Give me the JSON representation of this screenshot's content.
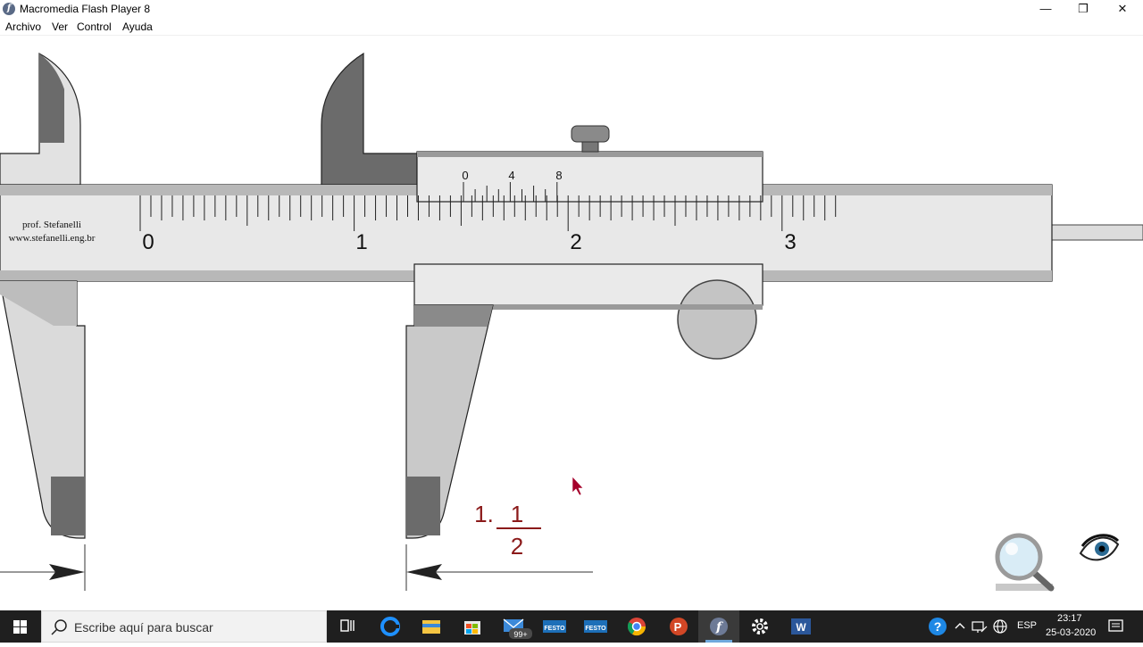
{
  "window": {
    "title": "Macromedia Flash Player 8",
    "controls": {
      "minimize": "—",
      "maximize": "❐",
      "close": "✕"
    }
  },
  "menu": [
    "Archivo",
    "Ver",
    "Control",
    "Ayuda"
  ],
  "caliper": {
    "credit_name": "prof. Stefanelli",
    "credit_url": "www.stefanelli.eng.br",
    "main_scale_labels": [
      "0",
      "1",
      "2",
      "3"
    ],
    "vernier_scale_labels": [
      "0",
      "4",
      "8"
    ],
    "colors": {
      "body": "#e6e6e6",
      "shade": "#bdbdbd",
      "dark": "#6b6b6b",
      "outline": "#1a1a1a"
    }
  },
  "answer": {
    "whole": "1.",
    "numerator": "1",
    "denominator": "2",
    "color": "#8b1a1a"
  },
  "tools": {
    "zoom": "magnifier-icon",
    "view": "eye-icon"
  },
  "taskbar": {
    "search_placeholder": "Escribe aquí para buscar",
    "mail_badge": "99+",
    "festo_label": "FESTO",
    "language": "ESP",
    "time": "23:17",
    "date": "25-03-2020"
  }
}
